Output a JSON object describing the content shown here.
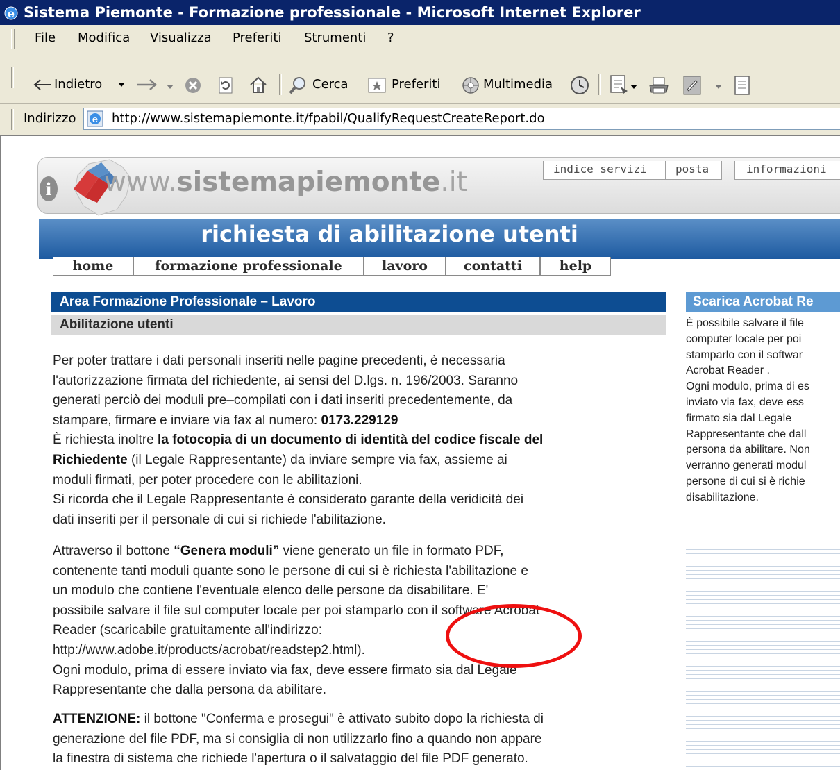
{
  "window": {
    "title": "Sistema Piemonte - Formazione professionale - Microsoft Internet Explorer"
  },
  "menu": [
    "File",
    "Modifica",
    "Visualizza",
    "Preferiti",
    "Strumenti",
    "?"
  ],
  "toolbar": {
    "back": "Indietro",
    "search": "Cerca",
    "favorites": "Preferiti",
    "media": "Multimedia"
  },
  "address": {
    "label": "Indirizzo",
    "url": "http://www.sistemapiemonte.it/fpabil/QualifyRequestCreateReport.do"
  },
  "site": {
    "logo_prefix": "www.",
    "logo_name": "sistemapiemonte",
    "logo_suffix": ".it",
    "top_links": [
      "indice servizi",
      "posta",
      "informazioni"
    ],
    "banner_title": "richiesta di abilitazione utenti",
    "nav": [
      "home",
      "formazione professionale",
      "lavoro",
      "contatti",
      "help"
    ]
  },
  "main": {
    "section_title": "Area Formazione Professionale – Lavoro",
    "subsection_title": "Abilitazione utenti",
    "p1_line1": "Per poter trattare i dati personali inseriti nelle pagine precedenti, è necessaria",
    "p1_line2": "l'autorizzazione firmata del richiedente, ai sensi del D.lgs. n. 196/2003. Saranno",
    "p1_line3": "generati perciò dei moduli pre–compilati con i dati inseriti precedentemente, da",
    "p1_line4": "stampare, firmare e inviare via fax al numero: ",
    "fax_number": "0173.229129",
    "p1_line5_pre": "È richiesta inoltre ",
    "p1_line5_bold": "la fotocopia di un documento di identità del codice fiscale del",
    "p1_line6_bold": "Richiedente",
    "p1_line6_rest": " (il Legale Rappresentante) da inviare sempre via fax, assieme ai",
    "p1_line7": "moduli firmati, per poter procedere con le abilitazioni.",
    "p1_line8": "Si ricorda che il Legale Rappresentante è considerato garante della veridicità dei",
    "p1_line9": "dati inseriti per il personale di cui si richiede l'abilitazione.",
    "p2_line1_pre": "Attraverso il bottone ",
    "p2_line1_bold": "“Genera moduli”",
    "p2_line1_rest": " viene generato un file in formato PDF,",
    "p2_line2": "contenente tanti moduli quante sono le persone di cui si è richiesta l'abilitazione e",
    "p2_line3": "un modulo che contiene l'eventuale elenco delle persone da disabilitare. E'",
    "p2_line4": "possibile salvare il file sul computer locale per poi stamparlo con il software Acrobat",
    "p2_line5": "Reader (scaricabile gratuitamente all'indirizzo:",
    "p2_line6": "http://www.adobe.it/products/acrobat/readstep2.html).",
    "p2_line7": "Ogni modulo, prima di essere inviato via fax, deve essere firmato sia dal Legale",
    "p2_line8": "Rappresentante che dalla persona da abilitare.",
    "p3_bold": "ATTENZIONE:",
    "p3_line1_rest": " il bottone \"Conferma e prosegui\" è attivato subito dopo la richiesta di",
    "p3_line2": "generazione del file PDF, ma si consiglia di non utilizzarlo fino a quando non appare",
    "p3_line3": "la finestra di sistema che richiede l'apertura o il salvataggio del file PDF generato."
  },
  "sidebar": {
    "title": "Scarica Acrobat Re",
    "lines": [
      "È possibile salvare il file",
      "computer locale per poi",
      "stamparlo con il softwar",
      "Acrobat Reader .",
      "Ogni modulo, prima di es",
      "inviato via fax, deve ess",
      "firmato sia dal Legale",
      "Rappresentante che dall",
      "persona da abilitare. Non",
      "verranno generati modul",
      "persone di cui si è richie",
      "disabilitazione."
    ]
  },
  "colors": {
    "title_bar": "#0a246a",
    "section_bar": "#0d4d92",
    "sidebar_head": "#5d9ad3",
    "annotation": "#ee1010"
  }
}
